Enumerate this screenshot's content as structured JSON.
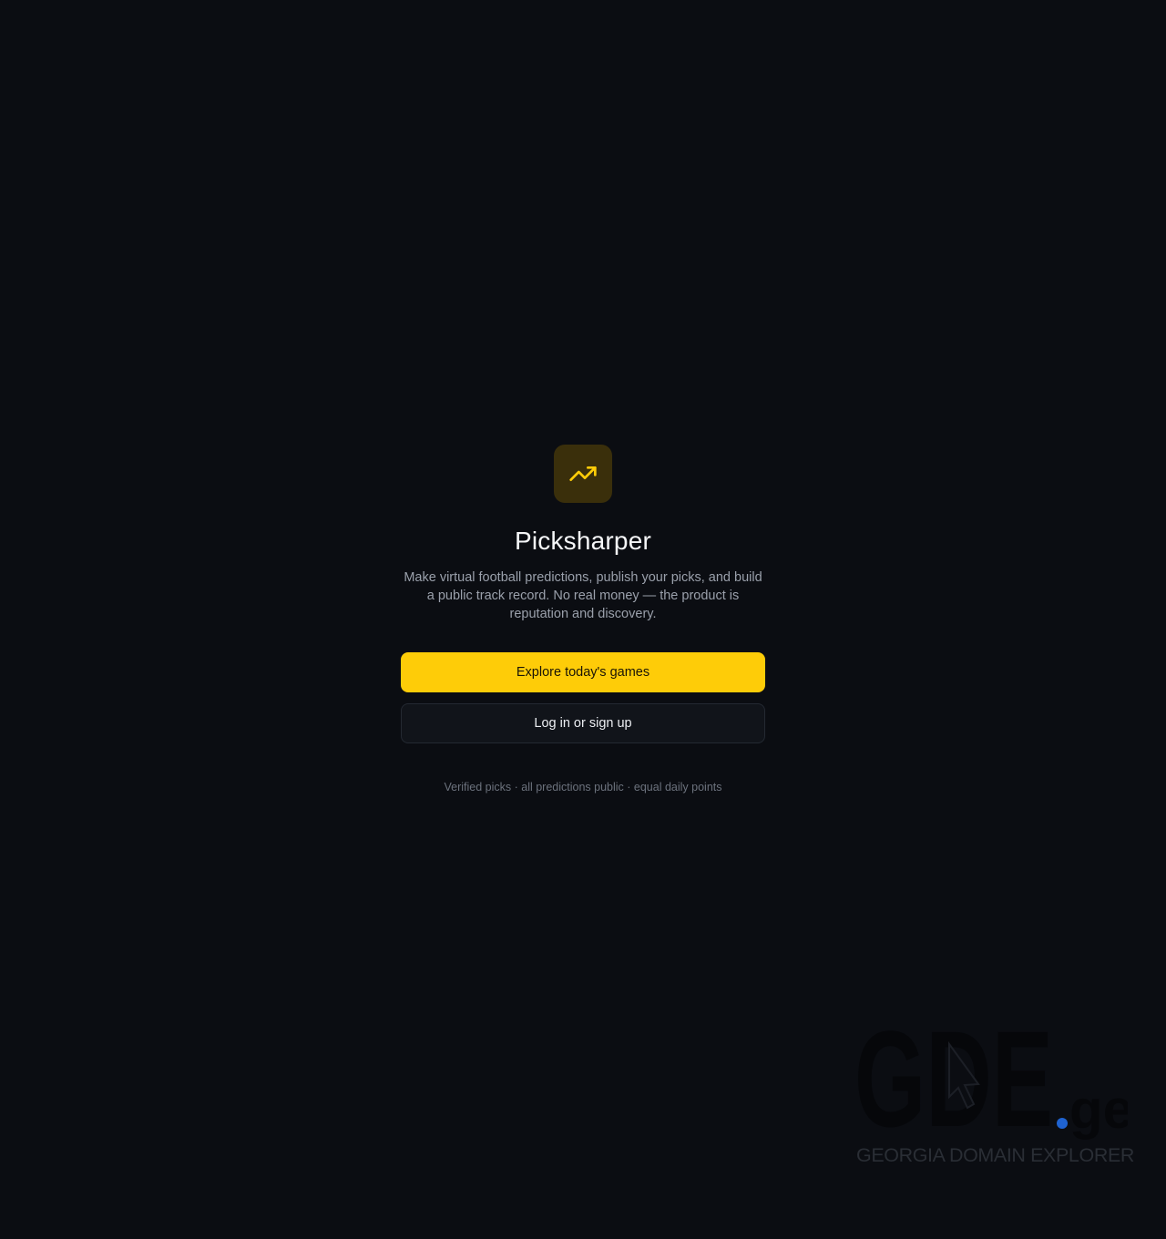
{
  "app": {
    "icon": "trending-up-icon",
    "name": "Picksharper",
    "tagline": "Make virtual football predictions, publish your picks, and build a public track record. No real money — the product is reputation and discovery."
  },
  "actions": {
    "primary_label": "Explore today's games",
    "secondary_label": "Log in or sign up"
  },
  "footnote": "Verified picks · all predictions public · equal daily points",
  "watermark": {
    "logo_text": "GDE.ge",
    "caption": "GEORGIA DOMAIN EXPLORER"
  },
  "colors": {
    "background": "#0b0d12",
    "accent": "#fecc08",
    "logo_tile": "#3a2f0b"
  }
}
